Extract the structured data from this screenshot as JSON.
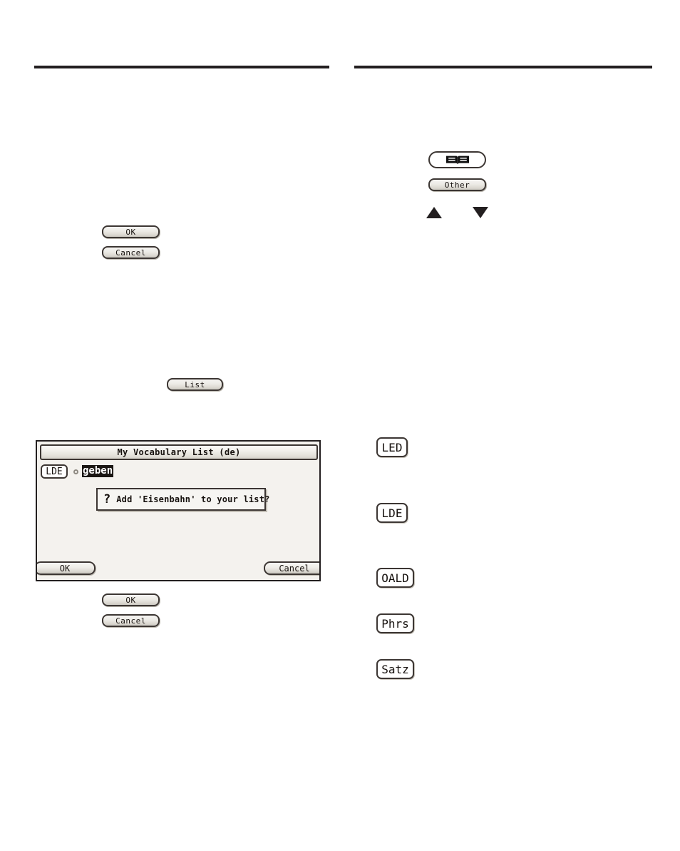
{
  "page": {
    "background_color": "#ffffff",
    "rule_color": "#231f20"
  },
  "left_column": {
    "rule": "",
    "buttons": [
      {
        "name": "ok-top",
        "label": "OK"
      },
      {
        "name": "cancel-top",
        "label": "Cancel"
      },
      {
        "name": "list",
        "label": "List"
      },
      {
        "name": "ok-bottom",
        "label": "OK"
      },
      {
        "name": "cancel-bottom",
        "label": "Cancel"
      }
    ],
    "dialog": {
      "title": "My Vocabulary List (de)",
      "entry": {
        "badge": "LDE",
        "bullet": "•",
        "word": "geben",
        "word_selected": true,
        "selection_bg": "#1a1613",
        "selection_fg": "#ffffff"
      },
      "message": {
        "icon": "?",
        "text": "Add 'Eisenbahn' to your list?"
      },
      "ok_label": "OK",
      "cancel_label": "Cancel"
    }
  },
  "right_column": {
    "rule": "",
    "book_key": {
      "icon": "open-book",
      "label": ""
    },
    "other_key": {
      "label": "Other"
    },
    "arrows": [
      {
        "name": "scroll-up",
        "glyph": "▲"
      },
      {
        "name": "scroll-down",
        "glyph": "▼"
      }
    ],
    "dictionary_keys": [
      {
        "name": "led",
        "label": "LED"
      },
      {
        "name": "lde",
        "label": "LDE"
      },
      {
        "name": "oald",
        "label": "OALD"
      },
      {
        "name": "phrs",
        "label": "Phrs"
      },
      {
        "name": "satz",
        "label": "Satz"
      }
    ]
  }
}
